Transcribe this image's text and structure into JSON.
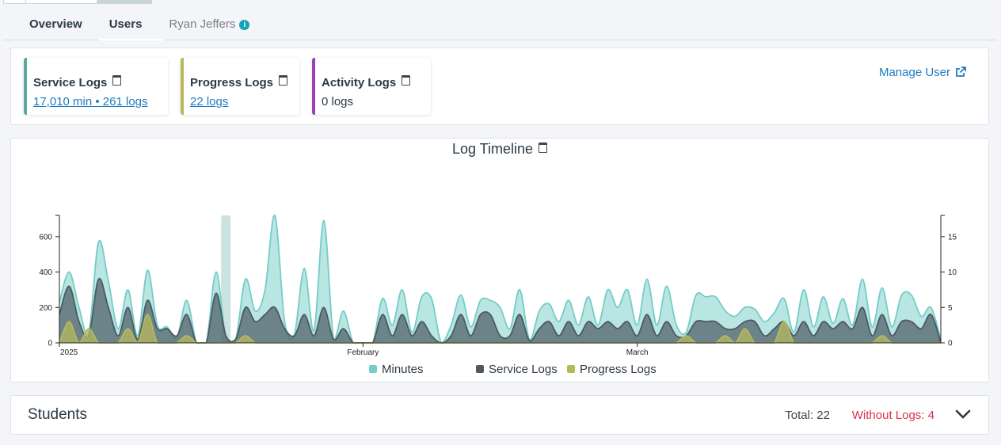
{
  "tabs": [
    {
      "label": "Overview",
      "active": false
    },
    {
      "label": "Users",
      "active": true
    },
    {
      "label": "Ryan Jeffers",
      "active": false,
      "icon": "info-icon"
    }
  ],
  "summary": {
    "cards": [
      {
        "title": "Service Logs",
        "value": "17,010 min • 261 logs",
        "color": "#5ea8a4",
        "link": true
      },
      {
        "title": "Progress Logs",
        "value": "22 logs",
        "color": "#b8b85a",
        "link": true
      },
      {
        "title": "Activity Logs",
        "value": "0 logs",
        "color": "#9b44b3",
        "link": false
      }
    ],
    "manage_label": "Manage User"
  },
  "chart_data": {
    "type": "area",
    "title": "Log Timeline",
    "x_tick_labels": [
      "2025",
      "February",
      "March"
    ],
    "y_left_ticks": [
      0,
      200,
      400,
      600
    ],
    "y_right_ticks": [
      0,
      5,
      10,
      15
    ],
    "ylim_left": [
      0,
      720
    ],
    "ylim_right": [
      0,
      18
    ],
    "x": [
      0,
      1,
      2,
      3,
      4,
      5,
      6,
      7,
      8,
      9,
      10,
      11,
      12,
      13,
      14,
      15,
      16,
      17,
      18,
      19,
      20,
      21,
      22,
      23,
      24,
      25,
      26,
      27,
      28,
      29,
      30,
      31,
      32,
      33,
      34,
      35,
      36,
      37,
      38,
      39,
      40,
      41,
      42,
      43,
      44,
      45,
      46,
      47,
      48,
      49,
      50,
      51,
      52,
      53,
      54,
      55,
      56,
      57,
      58,
      59,
      60,
      61,
      62,
      63,
      64,
      65,
      66,
      67,
      68,
      69,
      70,
      71,
      72,
      73,
      74,
      75,
      76,
      77,
      78,
      79,
      80,
      81,
      82,
      83,
      84,
      85,
      86,
      87,
      88,
      89,
      90
    ],
    "series": [
      {
        "name": "Minutes",
        "axis": "left",
        "color": "#74cdc7",
        "values": [
          230,
          400,
          200,
          60,
          570,
          350,
          80,
          300,
          40,
          410,
          100,
          90,
          30,
          240,
          0,
          0,
          400,
          30,
          20,
          360,
          180,
          300,
          720,
          120,
          50,
          420,
          70,
          690,
          20,
          180,
          0,
          0,
          0,
          250,
          100,
          300,
          60,
          260,
          250,
          0,
          100,
          270,
          90,
          240,
          240,
          200,
          80,
          300,
          20,
          180,
          220,
          120,
          240,
          100,
          260,
          100,
          300,
          200,
          300,
          100,
          360,
          100,
          320,
          100,
          60,
          270,
          260,
          260,
          180,
          150,
          200,
          190,
          120,
          170,
          250,
          60,
          300,
          90,
          260,
          110,
          250,
          100,
          360,
          90,
          310,
          90,
          270,
          270,
          150,
          200,
          20
        ]
      },
      {
        "name": "Service Logs",
        "axis": "right",
        "color": "#4b5a62",
        "values": [
          4,
          8,
          3,
          1,
          9,
          5,
          1,
          5,
          0.5,
          6,
          2,
          2,
          1,
          4,
          0,
          0,
          7,
          1,
          0.5,
          5,
          3,
          4,
          5,
          2,
          1,
          4,
          1,
          5,
          0.5,
          2,
          0,
          0,
          0,
          4,
          1,
          4,
          1,
          3,
          1,
          0,
          1,
          4,
          1,
          4,
          4,
          1,
          1,
          4,
          0.3,
          2,
          3,
          1,
          3,
          1,
          3,
          2,
          3,
          2,
          3,
          1,
          4,
          1,
          3,
          1,
          1,
          3,
          3,
          3,
          2,
          2,
          3,
          3,
          1,
          2,
          3,
          1,
          3,
          1,
          3,
          2,
          3,
          2,
          5,
          1,
          4,
          1,
          3,
          3,
          2,
          4,
          0
        ]
      },
      {
        "name": "Progress Logs",
        "axis": "right",
        "color": "#b5b85c",
        "values": [
          0,
          3,
          0,
          2,
          0,
          0,
          0,
          2,
          0,
          4,
          0,
          0,
          0,
          1,
          0,
          0,
          0,
          0,
          0,
          1,
          0,
          0,
          0,
          0,
          0,
          0,
          0,
          0,
          0,
          0,
          0,
          0,
          0,
          0,
          0,
          0,
          0,
          0,
          0,
          0,
          0,
          0,
          0,
          0,
          0,
          0,
          0,
          0,
          0,
          0,
          0,
          0,
          0,
          0,
          0,
          0,
          0,
          0,
          0,
          0,
          0,
          0,
          0,
          0,
          1,
          0,
          0,
          0,
          1,
          0,
          2,
          0,
          0,
          0,
          3,
          0,
          0,
          0,
          0,
          0,
          0,
          0,
          0,
          0,
          1,
          0,
          0,
          0,
          0,
          0,
          0
        ]
      }
    ],
    "legend": [
      "Minutes",
      "Service Logs",
      "Progress Logs"
    ],
    "highlight_x": 17
  },
  "students": {
    "title": "Students",
    "total": "Total: 22",
    "without": "Without Logs: 4"
  }
}
